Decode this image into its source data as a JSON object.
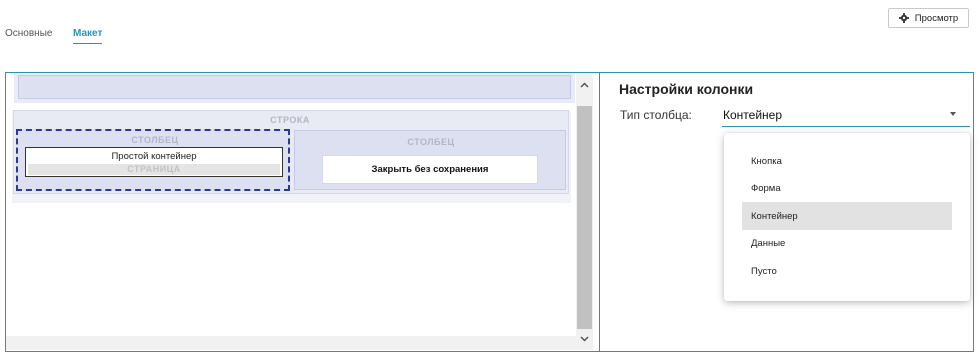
{
  "tabs": [
    {
      "label": "Основные",
      "active": false
    },
    {
      "label": "Макет",
      "active": true
    }
  ],
  "toolbar": {
    "preview_label": "Просмотр",
    "preview_icon": "gear-icon"
  },
  "canvas": {
    "row_label": "СТРОКА",
    "column1": {
      "label": "СТОЛБЕЦ",
      "container_text": "Простой контейнер",
      "page_label": "СТРАНИЦА"
    },
    "column2": {
      "label": "СТОЛБЕЦ",
      "button_label": "Закрыть без сохранения"
    }
  },
  "settings": {
    "title": "Настройки колонки",
    "column_type_label": "Тип столбца:",
    "column_type_value": "Контейнер",
    "options": [
      "Кнопка",
      "Форма",
      "Контейнер",
      "Данные",
      "Пусто"
    ],
    "selected_option": "Контейнер"
  },
  "colors": {
    "accent": "#2b93b0",
    "selection_border": "#2a3a9a"
  }
}
